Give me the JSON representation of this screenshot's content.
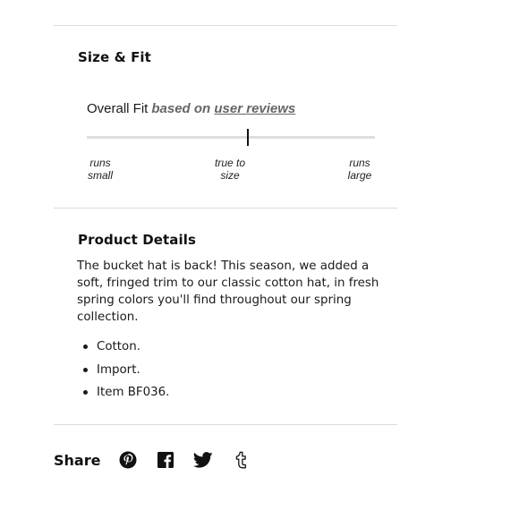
{
  "size_fit": {
    "title": "Size & Fit",
    "overall_fit_label": "Overall Fit",
    "based_on": "based on",
    "reviews_link": "user reviews",
    "fit_position_fraction": 0.56,
    "scale_labels": [
      {
        "line1": "runs",
        "line2": "small"
      },
      {
        "line1": "true to",
        "line2": "size"
      },
      {
        "line1": "runs",
        "line2": "large"
      }
    ]
  },
  "product_details": {
    "title": "Product Details",
    "description": "The bucket hat is back! This season, we added a soft, fringed trim to our classic cotton hat, in fresh spring colors you'll find throughout our spring collection.",
    "bullets": [
      "Cotton.",
      "Import.",
      "Item BF036."
    ]
  },
  "share": {
    "label": "Share",
    "icons": [
      "pinterest-icon",
      "facebook-icon",
      "twitter-icon",
      "tumblr-icon"
    ]
  }
}
